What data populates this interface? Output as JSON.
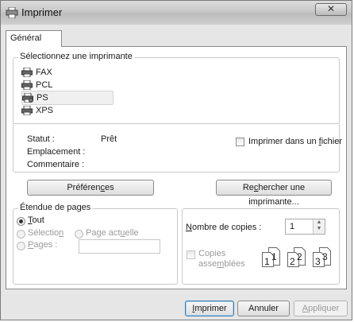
{
  "window": {
    "title": "Imprimer",
    "close_label": "✕"
  },
  "tabs": [
    {
      "label": "Général"
    }
  ],
  "printers": {
    "legend": "Sélectionnez une imprimante",
    "items": [
      {
        "label": "FAX"
      },
      {
        "label": "PCL"
      },
      {
        "label": "PS",
        "selected": true
      },
      {
        "label": "XPS"
      }
    ]
  },
  "status": {
    "statut_label": "Statut :",
    "statut_value": "Prêt",
    "emplacement_label": "Emplacement :",
    "commentaire_label": "Commentaire :",
    "print_to_file_pre": "Imprimer dans un ",
    "print_to_file_key": "f",
    "print_to_file_post": "ichier"
  },
  "buttons": {
    "preferences_pre": "Préféren",
    "preferences_key": "c",
    "preferences_post": "es",
    "find_printer_pre": "Re",
    "find_printer_key": "c",
    "find_printer_post": "hercher une imprimante...",
    "print_key": "I",
    "print_post": "mprimer",
    "cancel": "Annuler",
    "apply_key": "A",
    "apply_post": "ppliquer"
  },
  "page_range": {
    "legend": "Étendue de pages",
    "all_key": "T",
    "all_post": "out",
    "selection_pre": "Sélectio",
    "selection_key": "n",
    "current_pre": "Page act",
    "current_key": "u",
    "current_post": "elle",
    "pages_key": "P",
    "pages_post": "ages :"
  },
  "copies": {
    "count_key": "N",
    "count_post": "ombre de copies :",
    "count_value": "1",
    "collate_line1": "Copies",
    "collate_pre": "asse",
    "collate_key": "m",
    "collate_post": "blées",
    "collate_digits": [
      "1",
      "1",
      "2",
      "2",
      "3",
      "3"
    ]
  }
}
